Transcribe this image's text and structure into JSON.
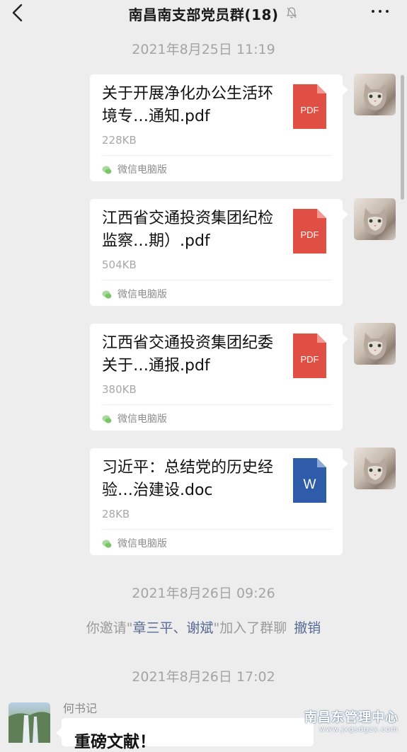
{
  "header": {
    "title": "南昌南支部党员群(18)",
    "back_icon": "chevron-left-icon",
    "mute_icon": "bell-off-icon",
    "more_icon": "more-dots-icon"
  },
  "timestamps": [
    "2021年8月25日 11:19",
    "2021年8月26日 09:26",
    "2021年8月26日 17:02"
  ],
  "messages": [
    {
      "file_name": "关于开展净化办公生活环境专…通知.pdf",
      "size": "228KB",
      "source": "微信电脑版",
      "type": "pdf",
      "badge": "PDF",
      "badge_color": "#e04f43"
    },
    {
      "file_name": "江西省交通投资集团纪检监察…期）.pdf",
      "size": "504KB",
      "source": "微信电脑版",
      "type": "pdf",
      "badge": "PDF",
      "badge_color": "#e04f43"
    },
    {
      "file_name": "江西省交通投资集团纪委关于…通报.pdf",
      "size": "380KB",
      "source": "微信电脑版",
      "type": "pdf",
      "badge": "PDF",
      "badge_color": "#e04f43"
    },
    {
      "file_name": "习近平：总结党的历史经验…治建设.doc",
      "size": "28KB",
      "source": "微信电脑版",
      "type": "doc",
      "badge": "W",
      "badge_color": "#2e5ca8"
    }
  ],
  "system_notice": {
    "prefix": "你邀请\"",
    "names": "章三平、谢斌",
    "suffix": "\"加入了群聊",
    "action": "撤销"
  },
  "incoming": {
    "sender": "何书记",
    "text": "重磅文献！"
  },
  "watermark": {
    "line1": "南昌东管理中心",
    "line2": "www.jxgsdgzx.com"
  },
  "colors": {
    "background": "#ededed",
    "link": "#576b95",
    "pdf_red": "#e04f43",
    "word_blue": "#2e5ca8"
  }
}
